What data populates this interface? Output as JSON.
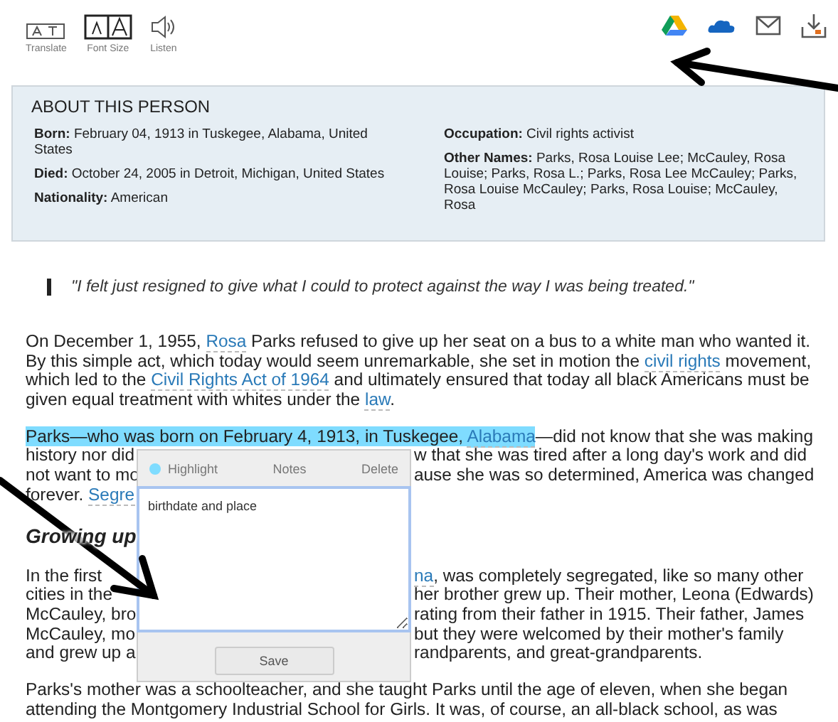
{
  "toolbar": {
    "tools": [
      {
        "kind": "translate",
        "label": "Translate"
      },
      {
        "kind": "font-size",
        "label": "Font Size"
      },
      {
        "kind": "listen",
        "label": "Listen"
      }
    ],
    "share": [
      {
        "kind": "drive"
      },
      {
        "kind": "cloud"
      },
      {
        "kind": "mail"
      },
      {
        "kind": "download"
      }
    ]
  },
  "about": {
    "title": "ABOUT THIS PERSON",
    "left": [
      {
        "label": "Born:",
        "value": "February 04, 1913 in Tuskegee, Alabama, United States"
      },
      {
        "label": "Died:",
        "value": "October 24, 2005 in Detroit, Michigan, United States"
      },
      {
        "label": "Nationality:",
        "value": "American"
      }
    ],
    "right": [
      {
        "label": "Occupation:",
        "value": "Civil rights activist"
      },
      {
        "label": "Other Names:",
        "value": "Parks, Rosa Louise Lee; McCauley, Rosa Louise; Parks, Rosa L.; Parks, Rosa Lee McCauley; Parks, Rosa Louise McCauley; Parks, Rosa Louise; McCauley, Rosa"
      }
    ]
  },
  "quote": "\"I felt just resigned to give what I could to protect against the way I was being treated.\"",
  "article": [
    {
      "kind": "paragraph",
      "lines": [
        {
          "left": [
            "On December 1, 1955, ",
            {
              "kind": "link",
              "text": "Rosa"
            },
            " Parks refused to give up her seat on a bus to a white man who wanted it."
          ]
        },
        {
          "left": [
            "By this simple act, which today would seem unremarkable, she set in motion the ",
            {
              "kind": "link",
              "text": "civil rights"
            },
            " movement,"
          ]
        },
        {
          "left": [
            "which led to the ",
            {
              "kind": "link",
              "text": "Civil Rights Act of 1964"
            },
            " and ultimately ensured that today all black Americans must be"
          ]
        },
        {
          "left": [
            "given equal treatment with whites under the ",
            {
              "kind": "link",
              "text": "law"
            },
            "."
          ]
        }
      ]
    },
    {
      "kind": "paragraph",
      "lines": [
        {
          "left": [
            {
              "kind": "highlight",
              "text": "Parks—who was born on February 4, 1913, in Tuskegee, "
            },
            {
              "kind": "highlight-link",
              "text": "Alabama"
            },
            "—did not know that she was making"
          ]
        },
        {
          "left": [
            "history nor did"
          ],
          "right": [
            "w that she was tired after a long day's work and did"
          ]
        },
        {
          "left": [
            "not want to mo"
          ],
          "right": [
            "ause she was so determined, America was changed"
          ]
        },
        {
          "left": [
            "forever. ",
            {
              "kind": "link",
              "text": "Segre"
            }
          ]
        }
      ]
    },
    {
      "kind": "heading",
      "text": "Growing up"
    },
    {
      "kind": "paragraph",
      "lines": [
        {
          "left": [
            "In the first"
          ],
          "right": [
            {
              "kind": "link",
              "text": "na"
            },
            ", was completely segregated, like so many other"
          ]
        },
        {
          "left": [
            "cities in the"
          ],
          "right": [
            "her brother grew up. Their mother, Leona (Edwards)"
          ]
        },
        {
          "left": [
            "McCauley, bro"
          ],
          "right": [
            "rating from their father in 1915. Their father, James"
          ]
        },
        {
          "left": [
            "McCauley, mo"
          ],
          "right": [
            "but they were welcomed by their mother's family"
          ]
        },
        {
          "left": [
            "and grew up a"
          ],
          "right": [
            "randparents, and great-grandparents."
          ]
        }
      ]
    },
    {
      "kind": "paragraph",
      "lines": [
        {
          "left": [
            "Parks's mother was a schoolteacher, and she taught Parks until the age of eleven, when she began"
          ]
        },
        {
          "left": [
            "attending the Montgomery Industrial School for Girls. It was, of course, an all-black school, as was"
          ]
        }
      ]
    }
  ],
  "note_popup": {
    "actions": [
      {
        "kind": "highlight",
        "label": "Highlight"
      },
      {
        "kind": "notes",
        "label": "Notes"
      },
      {
        "kind": "delete",
        "label": "Delete"
      }
    ],
    "note": "birthdate and place",
    "save": "Save"
  }
}
